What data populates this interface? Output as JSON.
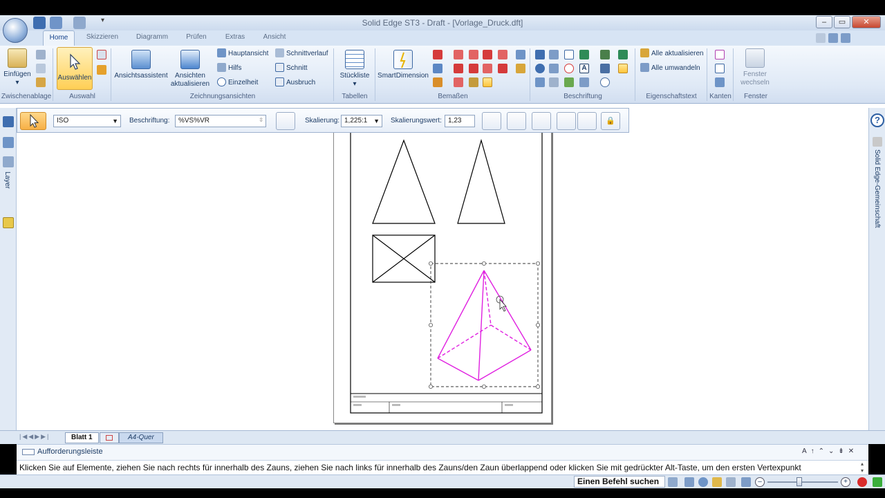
{
  "window": {
    "title": "Solid Edge ST3 - Draft - [Vorlage_Druck.dft]"
  },
  "tabs": [
    {
      "label": "Home"
    },
    {
      "label": "Skizzieren"
    },
    {
      "label": "Diagramm"
    },
    {
      "label": "Prüfen"
    },
    {
      "label": "Extras"
    },
    {
      "label": "Ansicht"
    }
  ],
  "ribbon": {
    "groups": {
      "zwischenablage": "Zwischenablage",
      "auswahl": "Auswahl",
      "zeichnungsansichten": "Zeichnungsansichten",
      "tabellen": "Tabellen",
      "bemassen": "Bemaßen",
      "beschriftung": "Beschriftung",
      "eigenschaftstext": "Eigenschaftstext",
      "kanten": "Kanten",
      "fenster": "Fenster"
    },
    "einfuegen": "Einfügen",
    "auswaehlen": "Auswählen",
    "ansichtsassistent": "Ansichtsassistent",
    "ansichten_1": "Ansichten",
    "ansichten_2": "aktualisieren",
    "hauptansicht": "Hauptansicht",
    "hilfs": "Hilfs",
    "einzelheit": "Einzelheit",
    "schnittverlauf": "Schnittverlauf",
    "schnitt": "Schnitt",
    "ausbruch": "Ausbruch",
    "stueckliste": "Stückliste",
    "smartdimension": "SmartDimension",
    "alle_aktualisieren": "Alle aktualisieren",
    "alle_umwandeln": "Alle umwandeln",
    "fenster_1": "Fenster",
    "fenster_2": "wechseln"
  },
  "commandbar": {
    "standard_value": "ISO",
    "beschriftung_label": "Beschriftung:",
    "beschriftung_value": "%VS%VR",
    "skalierung_label": "Skalierung:",
    "skalierung_value": "1,225:1",
    "skalierungswert_label": "Skalierungswert:",
    "skalierungswert_value": "1,23"
  },
  "side": {
    "layer": "Layer",
    "community": "Solid Edge-Gemeinschaft"
  },
  "sheets": {
    "active": "Blatt 1",
    "second": "A4-Quer"
  },
  "prompt": {
    "title": "Aufforderungsleiste",
    "message": "Klicken Sie auf Elemente, ziehen Sie nach rechts für innerhalb des Zauns, ziehen Sie nach links für innerhalb des Zauns/den Zaun überlappend oder klicken Sie mit gedrückter Alt-Taste, um den ersten Vertexpunkt"
  },
  "status": {
    "search": "Einen Befehl suchen"
  },
  "colors": {
    "accent": "#e020e0",
    "ribbon": "#dfe9f6",
    "selected": "#ffd35a"
  }
}
